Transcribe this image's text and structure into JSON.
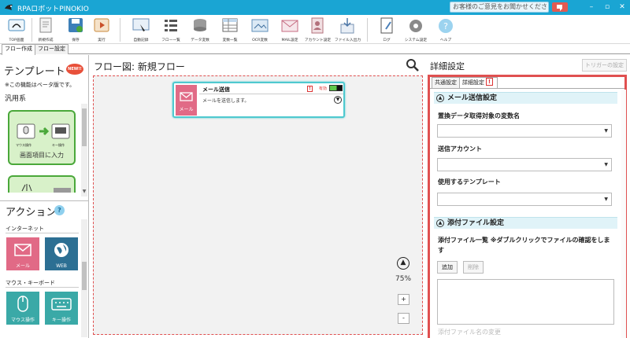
{
  "window": {
    "title": "RPAロボットPINOKIO",
    "feedback": "お客様のご意見をお聞かせください",
    "controls": [
      "–",
      "▫",
      "✕"
    ]
  },
  "toolbar": {
    "items": [
      {
        "label": "TOP画面",
        "icon": "home-icon"
      },
      {
        "label": "新規作成",
        "icon": "new-document-icon"
      },
      {
        "label": "保存",
        "icon": "save-icon"
      },
      {
        "label": "実行",
        "icon": "play-icon"
      },
      {
        "label": "自動記録",
        "icon": "auto-record-icon"
      },
      {
        "label": "フロー一覧",
        "icon": "flow-list-icon"
      },
      {
        "label": "データ変数",
        "icon": "data-variable-icon"
      },
      {
        "label": "変数一覧",
        "icon": "variable-list-icon"
      },
      {
        "label": "OCR変数",
        "icon": "ocr-icon"
      },
      {
        "label": "MAIL設定",
        "icon": "mail-settings-icon"
      },
      {
        "label": "アカウント設定",
        "icon": "account-settings-icon"
      },
      {
        "label": "ファイル入出力",
        "icon": "file-io-icon"
      },
      {
        "label": "ログ",
        "icon": "log-icon"
      },
      {
        "label": "システム設定",
        "icon": "system-settings-icon"
      },
      {
        "label": "ヘルプ",
        "icon": "help-icon"
      }
    ]
  },
  "main_tabs": [
    "フロー作成",
    "フロー設定"
  ],
  "left": {
    "template_title": "テンプレート",
    "new_badge": "NEW!!",
    "beta_note": "※この機能はベータ版です。",
    "group": "汎用系",
    "template_card": {
      "caption": "画面項目に入力",
      "sub1": "マウス操作",
      "sub2": "キー操作"
    },
    "action_title": "アクション",
    "help": "?",
    "categories": [
      {
        "name": "インターネット",
        "tiles": [
          {
            "label": "メール",
            "color": "#e16a86"
          },
          {
            "label": "WEB",
            "color": "#2c6f93"
          }
        ]
      },
      {
        "name": "マウス・キーボード",
        "tiles": [
          {
            "label": "マウス操作",
            "color": "#3aa9a7"
          },
          {
            "label": "キー操作",
            "color": "#3aa9a7"
          }
        ]
      }
    ]
  },
  "canvas": {
    "title": "フロー図:  新規フロー",
    "zoom": "75%",
    "zoom_in": "+",
    "zoom_out": "-",
    "node": {
      "title": "メール送信",
      "description": "メールを送信します。",
      "icon_label": "メール",
      "state": "有効",
      "warn": "!"
    }
  },
  "right": {
    "title": "詳細設定",
    "trigger_button": "トリガーの設定",
    "tabs": [
      "共通設定",
      "詳細設定"
    ],
    "section1": "メール送信設定",
    "fields": [
      {
        "label": "置換データ取得対象の変数名",
        "value": ""
      },
      {
        "label": "送信アカウント",
        "value": ""
      },
      {
        "label": "使用するテンプレート",
        "value": ""
      }
    ],
    "section2": "添付ファイル設定",
    "attach_label": "添付ファイル一覧 ※ダブルクリックでファイルの確認をします",
    "add_button": "追加",
    "delete_button": "削除",
    "cut_label": "添付ファイル名の変更"
  }
}
